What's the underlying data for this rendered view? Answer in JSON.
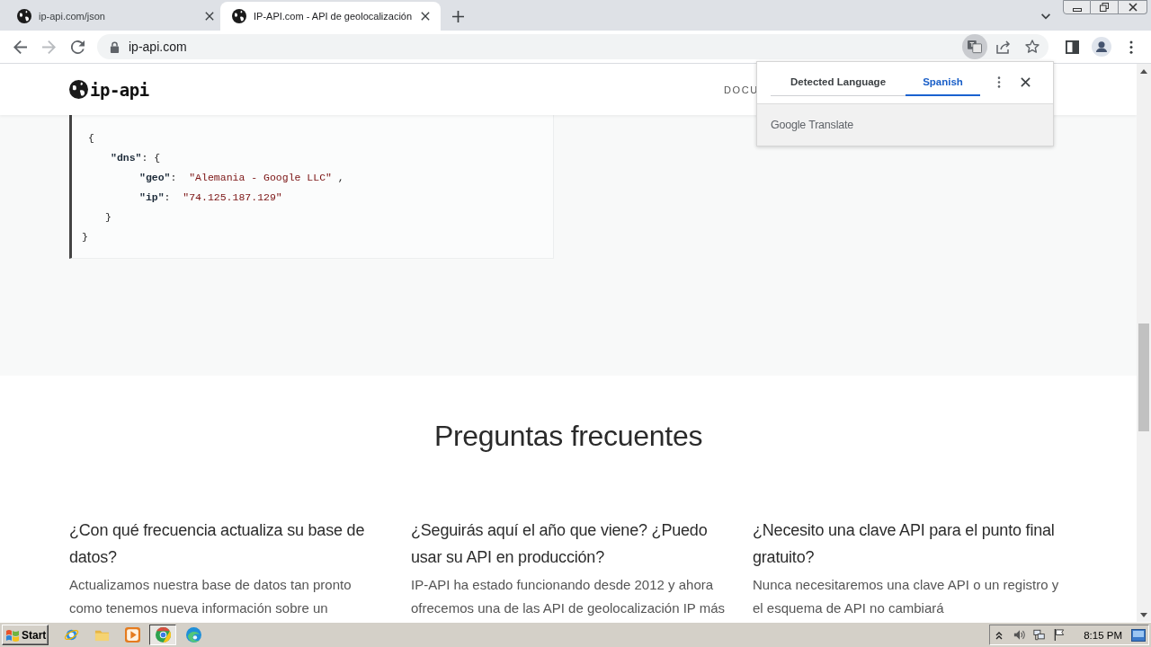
{
  "browser": {
    "tabs": [
      {
        "title": "ip-api.com/json",
        "selected": false
      },
      {
        "title": "IP-API.com - API de geolocalización",
        "selected": true
      }
    ],
    "nav_buttons": [
      {
        "kind": "back",
        "disabled": false
      },
      {
        "kind": "forward",
        "disabled": true
      },
      {
        "kind": "reload",
        "disabled": false
      }
    ],
    "address": "ip-api.com",
    "translate_active": true
  },
  "translate_popup": {
    "tabs": [
      {
        "label": "Detected Language",
        "selected": false
      },
      {
        "label": "Spanish",
        "selected": true
      }
    ],
    "footer": "Google Translate"
  },
  "site_header": {
    "logo": "ip-api",
    "nav": [
      "DOCU"
    ]
  },
  "code_block": {
    "root": {
      "open": "{",
      "close": "}",
      "children": [
        {
          "key": "\"dns\"",
          "colon": ":",
          "open": "{",
          "close": "}",
          "children": [
            {
              "key": "\"geo\"",
              "colon": ":",
              "value": "\"Alemania - Google LLC\"",
              "comma": ","
            },
            {
              "key": "\"ip\"",
              "colon": ":",
              "value": "\"74.125.187.129\""
            }
          ]
        }
      ]
    }
  },
  "faq": {
    "title": "Preguntas frecuentes",
    "items": [
      {
        "question_lines": [
          "¿Con qué frecuencia actualiza su base de",
          "datos?"
        ],
        "answer_lines": [
          "Actualizamos nuestra base de datos tan pronto",
          "como tenemos nueva información sobre un"
        ]
      },
      {
        "question_lines": [
          "¿Seguirás aquí el año que viene? ¿Puedo",
          "usar su API en producción?"
        ],
        "answer_lines": [
          "IP-API ha estado funcionando desde 2012 y ahora",
          "ofrecemos una de las API de geolocalización IP más"
        ]
      },
      {
        "question_lines": [
          "¿Necesito una clave API para el punto final",
          "gratuito?"
        ],
        "answer_lines": [
          "Nunca necesitaremos una clave API o un registro y",
          "el esquema de API no cambiará"
        ]
      }
    ]
  },
  "taskbar": {
    "start": "Start",
    "apps": [
      {
        "kind": "ie",
        "active": false
      },
      {
        "kind": "folder",
        "active": false
      },
      {
        "kind": "media",
        "active": false
      },
      {
        "kind": "chrome",
        "active": true
      },
      {
        "kind": "edge",
        "active": false
      }
    ],
    "clock": "8:15 PM"
  }
}
